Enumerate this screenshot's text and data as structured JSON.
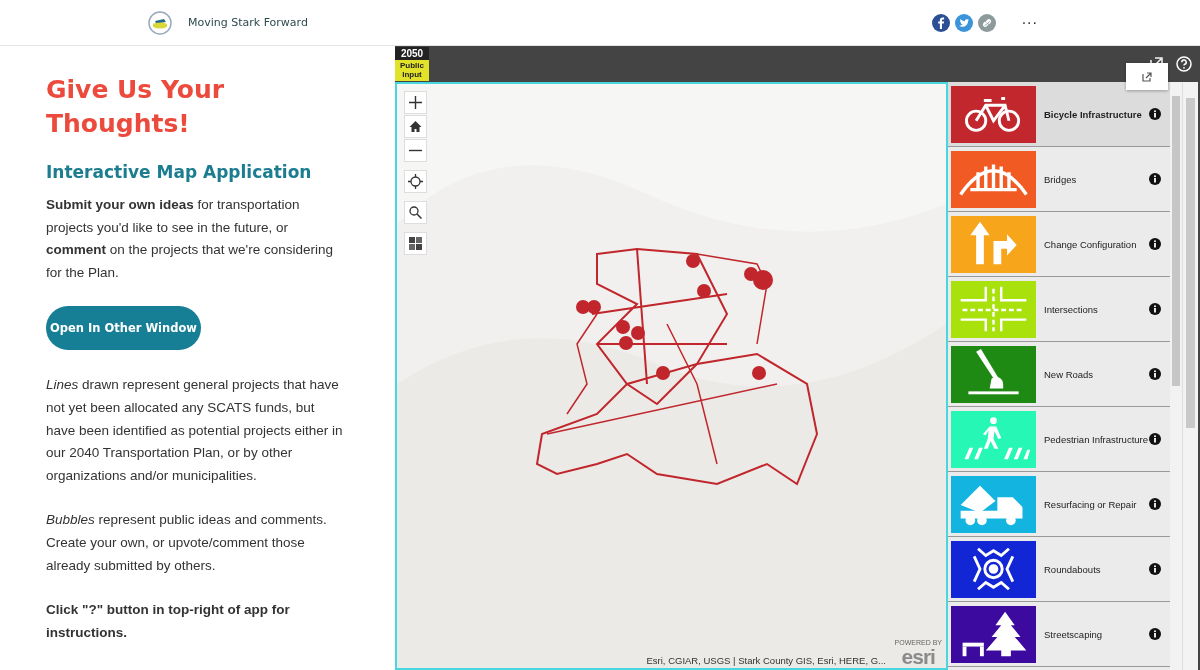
{
  "site_header": {
    "title": "Moving Stark Forward",
    "more": "···"
  },
  "story": {
    "heading": "Give Us Your Thoughts!",
    "subheading": "Interactive Map Application",
    "intro": "**Submit your own ideas** for transportation projects you'd like to see in the future, or **comment** on the projects that we're considering for the Plan.",
    "button": "Open In Other Window",
    "paragraphs": [
      "*Lines* drawn represent general projects that have not yet been allocated any SCATS funds, but have been identified as potential projects either in our 2040 Transportation Plan, or by other organizations and/or municipalities.",
      "*Bubbles* represent public ideas and comments. Create your own, or upvote/comment those already submitted by others.",
      "**Click \"?\" button in top-right of app for instructions.**"
    ]
  },
  "app": {
    "logo": {
      "year": "2050",
      "label": "Public Input"
    },
    "map": {
      "attribution": "Esri, CGIAR, USGS | Stark County GIS, Esri, HERE, G...",
      "powered": "POWERED BY",
      "esri": "esri"
    },
    "categories": [
      {
        "label": "Bicycle Infrastructure",
        "color": "#c1272d",
        "selected": true
      },
      {
        "label": "Bridges",
        "color": "#f15a22",
        "selected": false
      },
      {
        "label": "Change Configuration",
        "color": "#f7a51b",
        "selected": false
      },
      {
        "label": "Intersections",
        "color": "#a8e10c",
        "selected": false
      },
      {
        "label": "New Roads",
        "color": "#1e8a14",
        "selected": false
      },
      {
        "label": "Pedestrian Infrastructure",
        "color": "#26f7b4",
        "selected": false
      },
      {
        "label": "Resurfacing or Repair",
        "color": "#14b4e0",
        "selected": false
      },
      {
        "label": "Roundabouts",
        "color": "#1226d6",
        "selected": false
      },
      {
        "label": "Streetscaping",
        "color": "#3d0aa0",
        "selected": false
      }
    ]
  }
}
